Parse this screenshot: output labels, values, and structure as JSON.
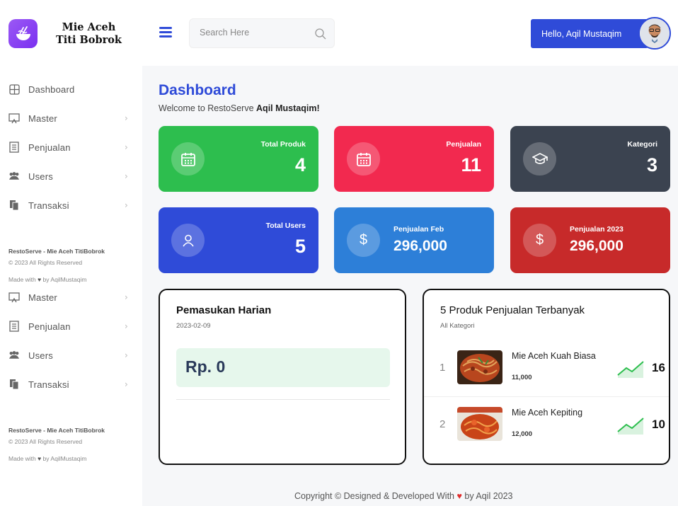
{
  "brand": {
    "line1": "Mie Aceh",
    "line2": "Titi Bobrok"
  },
  "sidebar": {
    "items": [
      {
        "label": "Dashboard",
        "icon": "dashboard-icon"
      },
      {
        "label": "Master",
        "icon": "monitor-icon"
      },
      {
        "label": "Penjualan",
        "icon": "receipt-icon"
      },
      {
        "label": "Users",
        "icon": "users-icon"
      },
      {
        "label": "Transaksi",
        "icon": "files-icon"
      }
    ],
    "items2": [
      {
        "label": "Master",
        "icon": "monitor-icon"
      },
      {
        "label": "Penjualan",
        "icon": "receipt-icon"
      },
      {
        "label": "Users",
        "icon": "users-icon"
      },
      {
        "label": "Transaksi",
        "icon": "files-icon"
      }
    ],
    "footer": {
      "title": "RestoServe - Mie Aceh TitiBobrok",
      "rights": "© 2023 All Rights Reserved",
      "made_pre": "Made with",
      "made_post": "by AqilMustaqim"
    }
  },
  "header": {
    "search_placeholder": "Search Here",
    "hello": "Hello, Aqil Mustaqim"
  },
  "main": {
    "title": "Dashboard",
    "welcome_pre": "Welcome to RestoServe",
    "welcome_name": "Aqil Mustaqim!"
  },
  "cards": [
    {
      "label": "Total Produk",
      "value": "4",
      "color": "#2dbe4e"
    },
    {
      "label": "Penjualan",
      "value": "11",
      "color": "#f2294f"
    },
    {
      "label": "Kategori",
      "value": "3",
      "color": "#3b4350"
    },
    {
      "label": "Total Users",
      "value": "5",
      "color": "#2f4bd8"
    },
    {
      "label": "Penjualan Feb",
      "value": "296,000",
      "color": "#2d7fd8"
    },
    {
      "label": "Penjualan 2023",
      "value": "296,000",
      "color": "#c72a2a"
    }
  ],
  "income": {
    "title": "Pemasukan Harian",
    "date": "2023-02-09",
    "value": "Rp. 0"
  },
  "top_products": {
    "title": "5 Produk Penjualan Terbanyak",
    "subtitle": "All Kategori",
    "rows": [
      {
        "rank": "1",
        "name": "Mie Aceh Kuah Biasa",
        "price": "11,000",
        "count": "16"
      },
      {
        "rank": "2",
        "name": "Mie Aceh Kepiting",
        "price": "12,000",
        "count": "10"
      }
    ]
  },
  "footer": {
    "pre": "Copyright © Designed & Developed With",
    "post": "by Aqil 2023"
  }
}
